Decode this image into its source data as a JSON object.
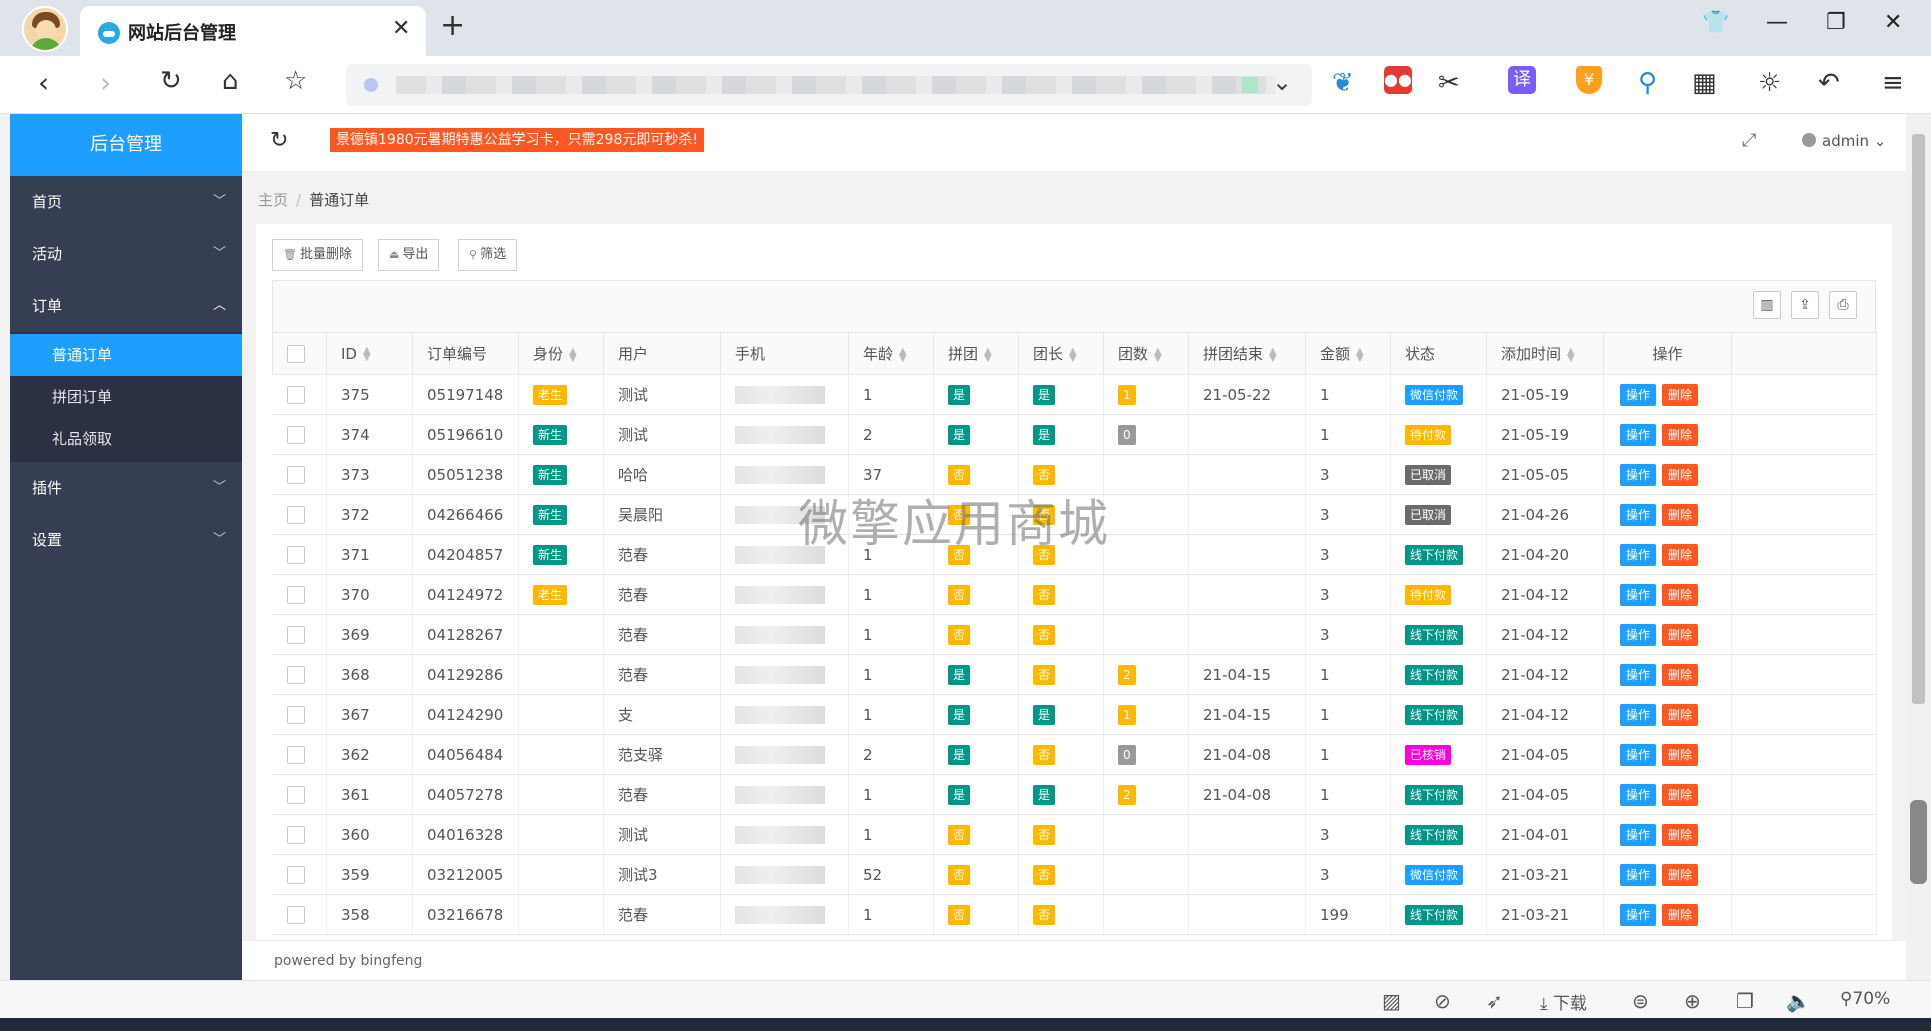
{
  "browser": {
    "tab_title": "网站后台管理",
    "zoom": "70%",
    "download_label": "下载",
    "translate_label": "译"
  },
  "sidebar": {
    "logo": "后台管理",
    "items": [
      {
        "label": "首页"
      },
      {
        "label": "活动"
      },
      {
        "label": "订单",
        "expanded": true,
        "children": [
          {
            "label": "普通订单",
            "active": true
          },
          {
            "label": "拼团订单"
          },
          {
            "label": "礼品领取"
          }
        ]
      },
      {
        "label": "插件"
      },
      {
        "label": "设置"
      }
    ]
  },
  "topbar": {
    "notice": "景德镇1980元暑期特惠公益学习卡，只需298元即可秒杀!",
    "user": "admin"
  },
  "breadcrumb": {
    "home": "主页",
    "sep": "/",
    "current": "普通订单"
  },
  "toolbar": {
    "batch_delete": "批量删除",
    "export": "导出",
    "filter": "筛选"
  },
  "table": {
    "columns": [
      "ID",
      "订单编号",
      "身份",
      "用户",
      "手机",
      "年龄",
      "拼团",
      "团长",
      "团数",
      "拼团结束",
      "金额",
      "状态",
      "添加时间",
      "操作"
    ],
    "op_edit": "操作",
    "op_delete": "删除",
    "rows": [
      {
        "id": "375",
        "order": "05197148",
        "role": "老生",
        "user": "测试",
        "age": "1",
        "group": "是",
        "leader": "是",
        "count": "1",
        "end": "21-05-22",
        "amount": "1",
        "status": "微信付款",
        "date": "21-05-19"
      },
      {
        "id": "374",
        "order": "05196610",
        "role": "新生",
        "user": "测试",
        "age": "2",
        "group": "是",
        "leader": "是",
        "count": "0",
        "end": "",
        "amount": "1",
        "status": "待付款",
        "date": "21-05-19"
      },
      {
        "id": "373",
        "order": "05051238",
        "role": "新生",
        "user": "哈哈",
        "age": "37",
        "group": "否",
        "leader": "否",
        "count": "",
        "end": "",
        "amount": "3",
        "status": "已取消",
        "date": "21-05-05"
      },
      {
        "id": "372",
        "order": "04266466",
        "role": "新生",
        "user": "吴晨阳",
        "age": "",
        "group": "否",
        "leader": "否",
        "count": "",
        "end": "",
        "amount": "3",
        "status": "已取消",
        "date": "21-04-26"
      },
      {
        "id": "371",
        "order": "04204857",
        "role": "新生",
        "user": "范春",
        "age": "1",
        "group": "否",
        "leader": "否",
        "count": "",
        "end": "",
        "amount": "3",
        "status": "线下付款",
        "date": "21-04-20"
      },
      {
        "id": "370",
        "order": "04124972",
        "role": "老生",
        "user": "范春",
        "age": "1",
        "group": "否",
        "leader": "否",
        "count": "",
        "end": "",
        "amount": "3",
        "status": "待付款",
        "date": "21-04-12"
      },
      {
        "id": "369",
        "order": "04128267",
        "role": "",
        "user": "范春",
        "age": "1",
        "group": "否",
        "leader": "否",
        "count": "",
        "end": "",
        "amount": "3",
        "status": "线下付款",
        "date": "21-04-12"
      },
      {
        "id": "368",
        "order": "04129286",
        "role": "",
        "user": "范春",
        "age": "1",
        "group": "是",
        "leader": "否",
        "count": "2",
        "end": "21-04-15",
        "amount": "1",
        "status": "线下付款",
        "date": "21-04-12"
      },
      {
        "id": "367",
        "order": "04124290",
        "role": "",
        "user": "支",
        "age": "1",
        "group": "是",
        "leader": "是",
        "count": "1",
        "end": "21-04-15",
        "amount": "1",
        "status": "线下付款",
        "date": "21-04-12"
      },
      {
        "id": "362",
        "order": "04056484",
        "role": "",
        "user": "范支驿",
        "age": "2",
        "group": "是",
        "leader": "否",
        "count": "0",
        "end": "21-04-08",
        "amount": "1",
        "status": "已核销",
        "date": "21-04-05"
      },
      {
        "id": "361",
        "order": "04057278",
        "role": "",
        "user": "范春",
        "age": "1",
        "group": "是",
        "leader": "是",
        "count": "2",
        "end": "21-04-08",
        "amount": "1",
        "status": "线下付款",
        "date": "21-04-05"
      },
      {
        "id": "360",
        "order": "04016328",
        "role": "",
        "user": "测试",
        "age": "1",
        "group": "否",
        "leader": "否",
        "count": "",
        "end": "",
        "amount": "3",
        "status": "线下付款",
        "date": "21-04-01"
      },
      {
        "id": "359",
        "order": "03212005",
        "role": "",
        "user": "测试3",
        "age": "52",
        "group": "否",
        "leader": "否",
        "count": "",
        "end": "",
        "amount": "3",
        "status": "微信付款",
        "date": "21-03-21"
      },
      {
        "id": "358",
        "order": "03216678",
        "role": "",
        "user": "范春",
        "age": "1",
        "group": "否",
        "leader": "否",
        "count": "",
        "end": "",
        "amount": "199",
        "status": "线下付款",
        "date": "21-03-21"
      }
    ]
  },
  "footer": "powered by bingfeng",
  "watermark": "微擎应用商城",
  "colors": {
    "primary": "#1e9fff",
    "sidebar": "#363e53",
    "teal": "#009688",
    "yellow": "#ffb800",
    "red": "#ff5722",
    "magenta": "#ff00d8"
  }
}
